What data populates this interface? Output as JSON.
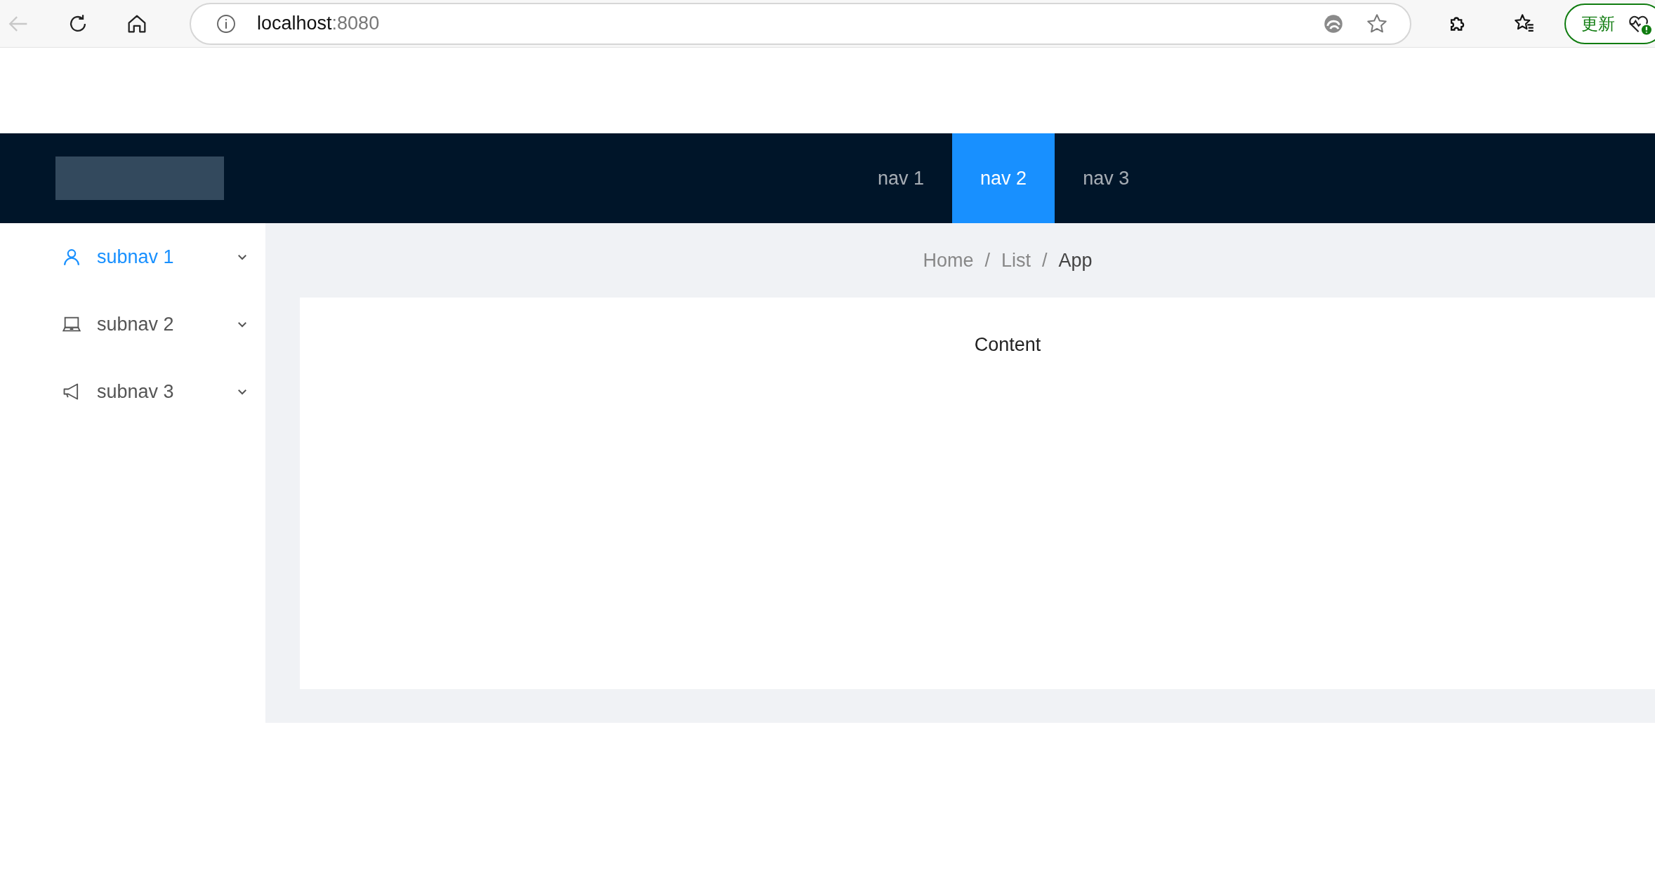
{
  "browser": {
    "url_host": "localhost",
    "url_port": ":8080",
    "update_button": "更新"
  },
  "header": {
    "nav": [
      {
        "label": "nav 1",
        "selected": false
      },
      {
        "label": "nav 2",
        "selected": true
      },
      {
        "label": "nav 3",
        "selected": false
      }
    ]
  },
  "sidebar": {
    "items": [
      {
        "label": "subnav 1",
        "kind": "user",
        "selected": true
      },
      {
        "label": "subnav 2",
        "kind": "laptop",
        "selected": false
      },
      {
        "label": "subnav 3",
        "kind": "notification",
        "selected": false
      }
    ]
  },
  "breadcrumb": [
    {
      "label": "Home",
      "selected": false
    },
    {
      "label": "List",
      "selected": false
    },
    {
      "label": "App",
      "selected": true
    }
  ],
  "breadcrumb_separator": "/",
  "content": {
    "text": "Content"
  }
}
